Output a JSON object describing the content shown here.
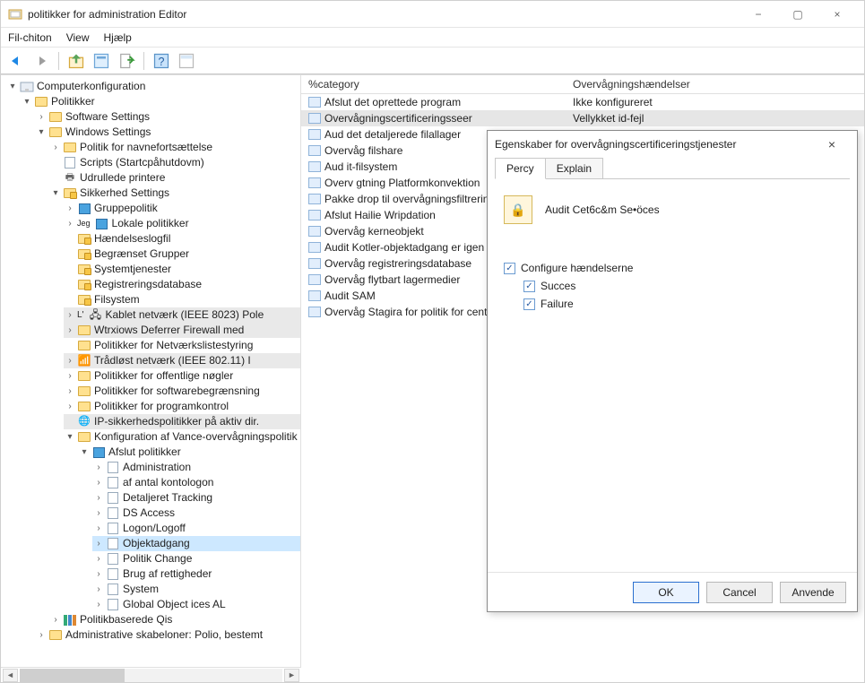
{
  "window": {
    "title": "politikker for administration Editor",
    "minimize": "−",
    "maximize": "▢",
    "close": "×"
  },
  "menu": {
    "file": "Fil-chiton",
    "view": "View",
    "help": "Hjælp"
  },
  "tree": {
    "root": "Computerkonfiguration",
    "politikker": "Politikker",
    "software": "Software Settings",
    "windows": "Windows Settings",
    "navne": "Politik for navnefortsættelse",
    "scripts": "Scripts (Startcpåhutdovm)",
    "udrullede": "Udrullede printere",
    "sikkerhed": "Sikkerhed Settings",
    "sikkerhed_a": "ⓐ",
    "gruppepolitik": "Gruppepolitik",
    "lokale": "Lokale politikker",
    "jeg": "Jeg",
    "haend": "Hændelseslogfil",
    "begraenset": "Begrænset Grupper",
    "systemtjen": "Systemtjenester",
    "regdb": "Registreringsdatabase",
    "filsystem": "Filsystem",
    "kablet": "Kablet netværk (IEEE 8023) Pole",
    "kablet_pre": "L'",
    "wtrx": "Wtrxiows Deferrer Firewall med",
    "netvaerks": "Politikker for Netværkslistestyring",
    "traadlost": "Trådløst netværk (IEEE 802.11) I",
    "offentlige": "Politikker for offentlige nøgler",
    "swbeg": "Politikker for softwarebegrænsning",
    "programk": "Politikker for programkontrol",
    "ipsik": "IP-sikkerhedspolitikker på aktiv dir.",
    "konfig": "Konfiguration af Vance-overvågningspolitik",
    "afslut": "Afslut politikker",
    "admin": "Administration",
    "kontologon": "af antal kontologon",
    "detaljeret": "Detaljeret Tracking",
    "dsaccess": "DS Access",
    "logon": "Logon/Logoff",
    "objektadgang": "Objektadgang",
    "politikchange": "Politik Change",
    "rettigheder": "Brug af rettigheder",
    "system": "System",
    "global": "Global Object ices AL",
    "polbaseret": "Politikbaserede Qis",
    "adminskab": "Administrative skabeloner: Polio, bestemt"
  },
  "list": {
    "hdr1": "%category",
    "hdr2": "Overvågningshændelser",
    "rows": [
      {
        "t": "Afslut det oprettede program",
        "v": "Ikke konfigureret"
      },
      {
        "t": "Overvågningscertificeringsseer",
        "v": "Vellykket id-fejl",
        "sel": true
      },
      {
        "t": "Aud det detaljerede filallager",
        "v": ""
      },
      {
        "t": "Overvåg filshare",
        "v": ""
      },
      {
        "t": "Aud it-filsystem",
        "v": ""
      },
      {
        "t": "Overv gtning Platformkonvektion",
        "v": ""
      },
      {
        "t": "Pakke drop til overvågningsfiltreringsplatform",
        "v": ""
      },
      {
        "t": "Afslut Hailie Wripdation",
        "v": ""
      },
      {
        "t": "Overvåg kerneobjekt",
        "v": ""
      },
      {
        "t": "Audit Kotler-objektadgang er igen",
        "v": ""
      },
      {
        "t": "Overvåg registreringsdatabase",
        "v": ""
      },
      {
        "t": "Overvåg flytbart lagermedier",
        "v": ""
      },
      {
        "t": "Audit SAM",
        "v": ""
      },
      {
        "t": "Overvåg Stagira for politik for central adgang",
        "v": ""
      }
    ]
  },
  "dialog": {
    "title": "Egenskaber for overvågningscertificeringstjenester",
    "tab1": "Percy",
    "tab2": "Explain",
    "name": "Audit Cet6c&m Se•öces",
    "configure": "Configure hændelserne",
    "success": "Succes",
    "failure": "Failure",
    "ok": "OK",
    "cancel": "Cancel",
    "apply": "Anvende"
  }
}
